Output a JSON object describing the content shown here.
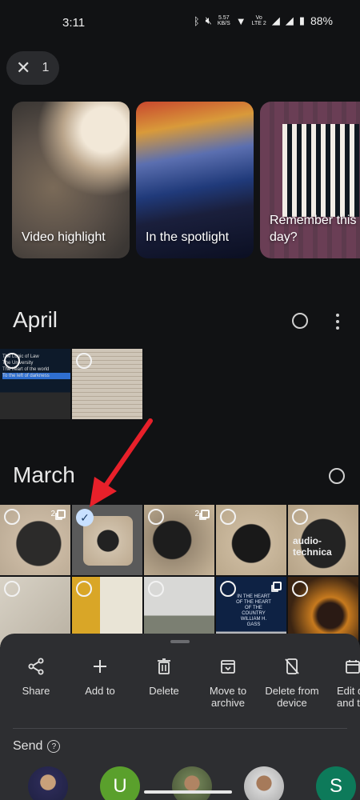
{
  "status_bar": {
    "time": "3:11",
    "net_speed_top": "5.57",
    "net_speed_bottom": "KB/S",
    "volte_top": "Vo",
    "volte_bottom": "LTE 2",
    "battery": "88%"
  },
  "selection": {
    "count": "1"
  },
  "memories": [
    {
      "label": "Video highlight"
    },
    {
      "label": "In the spotlight"
    },
    {
      "label": "Remember this day?"
    }
  ],
  "sections": {
    "april": {
      "title": "April"
    },
    "march": {
      "title": "March"
    }
  },
  "thumbs": {
    "laptop_menu": [
      "The Logic of Law",
      "The University",
      "The heart of the world",
      "To the left of darkness"
    ],
    "stack_count": "2",
    "case_brand": "audio-technica",
    "sign_text": "IN THE HEART OF THE HEART OF THE COUNTRY WILLIAM H. GASS"
  },
  "actions": [
    {
      "label": "Share",
      "icon": "share-icon"
    },
    {
      "label": "Add to",
      "icon": "plus-icon"
    },
    {
      "label": "Delete",
      "icon": "trash-icon"
    },
    {
      "label": "Move to archive",
      "icon": "archive-icon"
    },
    {
      "label": "Delete from device",
      "icon": "device-off-icon"
    },
    {
      "label": "Edit d and ti",
      "icon": "calendar-icon"
    }
  ],
  "send": {
    "title": "Send",
    "contacts": [
      {
        "initial": ""
      },
      {
        "initial": "U",
        "color": "#5aa02c"
      },
      {
        "initial": ""
      },
      {
        "initial": ""
      },
      {
        "initial": "S",
        "color": "#0d7a5a"
      }
    ]
  }
}
